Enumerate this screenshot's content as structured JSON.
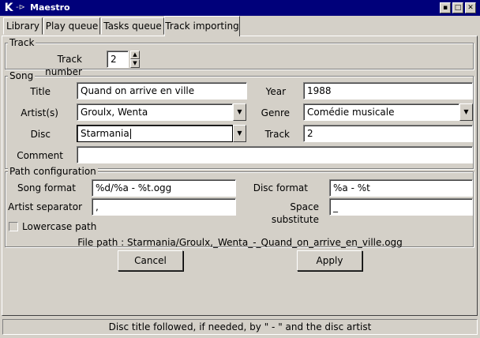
{
  "window": {
    "title": "Maestro",
    "k_logo": "K",
    "pin_glyph": "-⊳",
    "min_glyph": "▪",
    "max_glyph": "□",
    "close_glyph": "✕"
  },
  "tabs": [
    {
      "label": "Library"
    },
    {
      "label": "Play queue"
    },
    {
      "label": "Tasks queue"
    },
    {
      "label": "Track importing"
    }
  ],
  "track": {
    "group_label": "Track",
    "number_label": "Track number",
    "number_value": "2",
    "spin_up": "▲",
    "spin_down": "▼"
  },
  "song": {
    "group_label": "Song",
    "title_label": "Title",
    "title_value": "Quand on arrive en ville",
    "year_label": "Year",
    "year_value": "1988",
    "artists_label": "Artist(s)",
    "artists_value": "Groulx, Wenta",
    "genre_label": "Genre",
    "genre_value": "Comédie musicale",
    "disc_label": "Disc",
    "disc_value": "Starmania",
    "track_label": "Track",
    "track_value": "2",
    "comment_label": "Comment",
    "comment_value": "",
    "dropdown_arrow": "▼"
  },
  "path": {
    "group_label": "Path configuration",
    "song_format_label": "Song format",
    "song_format_value": "%d/%a - %t.ogg",
    "disc_format_label": "Disc format",
    "disc_format_value": "%a - %t",
    "artist_sep_label": "Artist separator",
    "artist_sep_value": ",",
    "space_sub_label": "Space substitute",
    "space_sub_value": "_",
    "lowercase_label": "Lowercase path",
    "lowercase_checked": false,
    "file_path_text": "File path : Starmania/Groulx,_Wenta_-_Quand_on_arrive_en_ville.ogg"
  },
  "buttons": {
    "cancel": "Cancel",
    "apply": "Apply"
  },
  "status": {
    "text": "Disc title followed, if needed, by \" - \" and the disc artist"
  }
}
